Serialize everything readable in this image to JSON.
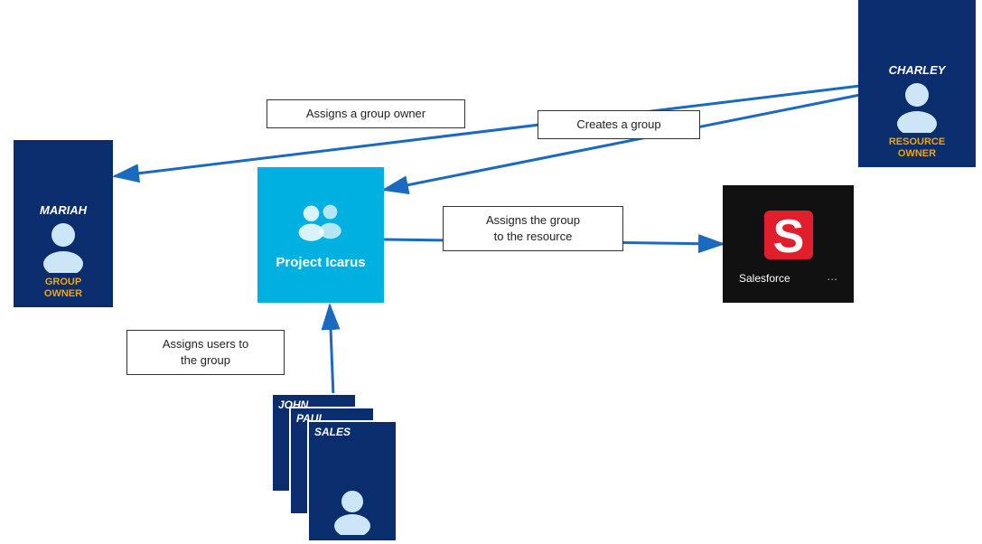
{
  "charley": {
    "name": "CHARLEY",
    "role_line1": "RESOURCE",
    "role_line2": "OWNER"
  },
  "mariah": {
    "name": "MARIAH",
    "role_line1": "GROUP",
    "role_line2": "OWNER"
  },
  "group": {
    "name": "Project Icarus"
  },
  "salesforce": {
    "name": "Salesforce",
    "dots": "..."
  },
  "labels": {
    "assigns_group_owner": "Assigns a group owner",
    "creates_group": "Creates a group",
    "assigns_group_resource": "Assigns the group\nto the resource",
    "assigns_users_group": "Assigns users to\nthe group"
  },
  "stacked_users": [
    {
      "name": "JOHN"
    },
    {
      "name": "PAUL"
    },
    {
      "name": "SALES"
    }
  ],
  "colors": {
    "dark_blue": "#0a2d6e",
    "cyan": "#00b0e0",
    "gold": "#f0a500",
    "arrow": "#1a6abf"
  }
}
